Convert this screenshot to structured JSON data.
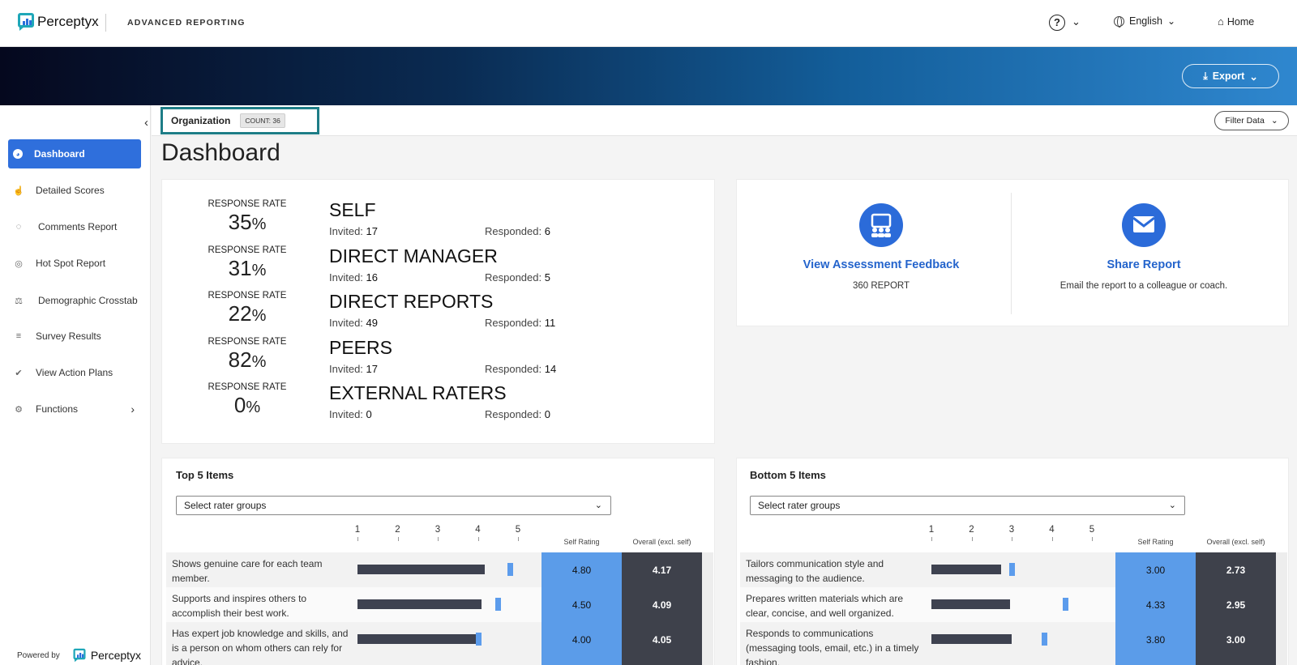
{
  "app": {
    "logo_text": "Perceptyx",
    "product": "ADVANCED REPORTING"
  },
  "topnav": {
    "help_icon": "?",
    "language": "English",
    "home": "Home"
  },
  "banner": {
    "export_label": "Export"
  },
  "sidebar": {
    "items": [
      {
        "label": "Dashboard",
        "icon": "dashboard-icon",
        "active": true
      },
      {
        "label": "Detailed Scores",
        "icon": "thumbs-up-icon"
      },
      {
        "label": "Comments Report",
        "icon": "comments-icon"
      },
      {
        "label": "Hot Spot Report",
        "icon": "target-icon"
      },
      {
        "label": "Demographic Crosstab",
        "icon": "scale-icon"
      },
      {
        "label": "Survey Results",
        "icon": "bar-chart-icon"
      },
      {
        "label": "View Action Plans",
        "icon": "check-circle-icon"
      },
      {
        "label": "Functions",
        "icon": "gear-icon"
      }
    ],
    "powered_by": "Powered by",
    "powered_logo": "Perceptyx"
  },
  "subbar": {
    "org_label": "Organization",
    "count": "COUNT: 36",
    "filter_label": "Filter Data"
  },
  "page_title": "Dashboard",
  "response": {
    "rate_label": "RESPONSE RATE",
    "invited_label": "Invited:",
    "responded_label": "Responded:",
    "groups": [
      {
        "name": "SELF",
        "rate": "35",
        "invited": "17",
        "responded": "6"
      },
      {
        "name": "DIRECT MANAGER",
        "rate": "31",
        "invited": "16",
        "responded": "5"
      },
      {
        "name": "DIRECT REPORTS",
        "rate": "22",
        "invited": "49",
        "responded": "11"
      },
      {
        "name": "PEERS",
        "rate": "82",
        "invited": "17",
        "responded": "14"
      },
      {
        "name": "EXTERNAL RATERS",
        "rate": "0",
        "invited": "0",
        "responded": "0"
      }
    ],
    "pct": "%"
  },
  "actions": {
    "assessment": {
      "title": "View Assessment Feedback",
      "sub": "360 REPORT"
    },
    "share": {
      "title": "Share Report",
      "sub": "Email the report to a colleague or coach."
    }
  },
  "top5": {
    "title": "Top 5 Items",
    "select": "Select rater groups",
    "scale": [
      "1",
      "2",
      "3",
      "4",
      "5"
    ],
    "self_header": "Self Rating",
    "overall_header": "Overall (excl. self)",
    "rows": [
      {
        "text": "Shows genuine care for each team member.",
        "self": "4.80",
        "overall": "4.17",
        "bar": 4.17,
        "mark": 4.8
      },
      {
        "text": "Supports and inspires others to accomplish their best work.",
        "self": "4.50",
        "overall": "4.09",
        "bar": 4.09,
        "mark": 4.5
      },
      {
        "text": "Has expert job knowledge and skills, and is a person on whom others can rely for advice.",
        "self": "4.00",
        "overall": "4.05",
        "bar": 4.05,
        "mark": 4.0
      }
    ]
  },
  "bottom5": {
    "title": "Bottom 5 Items",
    "select": "Select rater groups",
    "scale": [
      "1",
      "2",
      "3",
      "4",
      "5"
    ],
    "self_header": "Self Rating",
    "overall_header": "Overall (excl. self)",
    "rows": [
      {
        "text": "Tailors communication style and messaging to the audience.",
        "self": "3.00",
        "overall": "2.73",
        "bar": 2.73,
        "mark": 3.0
      },
      {
        "text": "Prepares written materials which are clear, concise, and well organized.",
        "self": "4.33",
        "overall": "2.95",
        "bar": 2.95,
        "mark": 4.33
      },
      {
        "text": "Responds to communications (messaging tools, email, etc.) in a timely fashion.",
        "self": "3.80",
        "overall": "3.00",
        "bar": 3.0,
        "mark": 3.8
      }
    ]
  },
  "colors": {
    "primary": "#2f6fdc",
    "self": "#5b9ce9",
    "overall": "#3e414b",
    "accent": "#1e7d87"
  }
}
